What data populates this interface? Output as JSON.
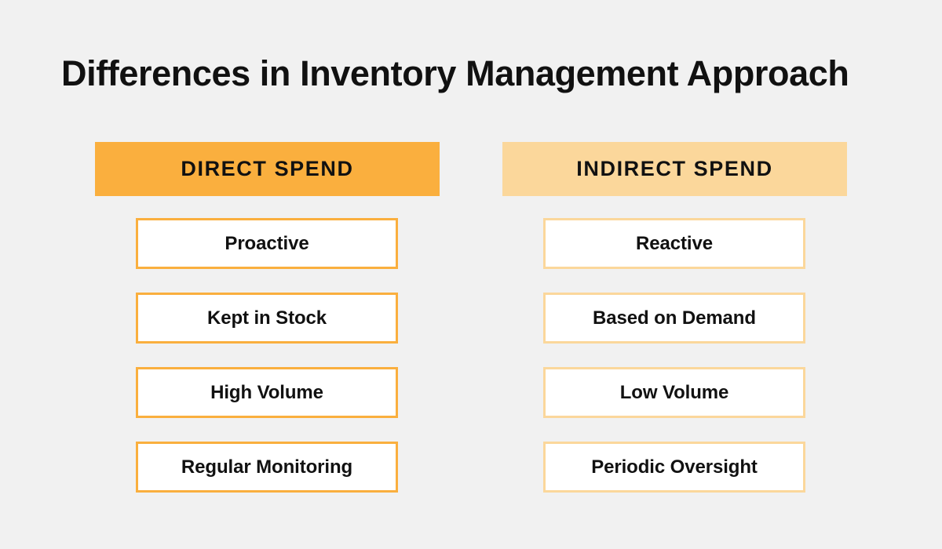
{
  "page": {
    "title": "Differences in Inventory Management Approach",
    "background_color": "#F1F1F1",
    "text_color": "#111111"
  },
  "chart_data": {
    "type": "table",
    "title": "Differences in Inventory Management Approach",
    "xlabel": "",
    "ylabel": "",
    "grid": false,
    "legend": "none",
    "orientation": "two-column-comparison",
    "columns": [
      "DIRECT SPEND",
      "INDIRECT SPEND"
    ],
    "rows": [
      [
        "Proactive",
        "Reactive"
      ],
      [
        "Kept in Stock",
        "Based on Demand"
      ],
      [
        "High Volume",
        "Low Volume"
      ],
      [
        "Regular Monitoring",
        "Periodic Oversight"
      ]
    ]
  },
  "columns": [
    {
      "id": "direct-spend",
      "header": "DIRECT SPEND",
      "header_bg": "#FAAF3E",
      "card_border": "#FAAF3E",
      "card_bg": "#FFFFFF",
      "items": [
        {
          "label": "Proactive"
        },
        {
          "label": "Kept in Stock"
        },
        {
          "label": "High Volume"
        },
        {
          "label": "Regular Monitoring"
        }
      ]
    },
    {
      "id": "indirect-spend",
      "header": "INDIRECT SPEND",
      "header_bg": "#FBD79B",
      "card_border": "#FBD79B",
      "card_bg": "#FFFFFF",
      "items": [
        {
          "label": "Reactive"
        },
        {
          "label": "Based on Demand"
        },
        {
          "label": "Low Volume"
        },
        {
          "label": "Periodic Oversight"
        }
      ]
    }
  ]
}
